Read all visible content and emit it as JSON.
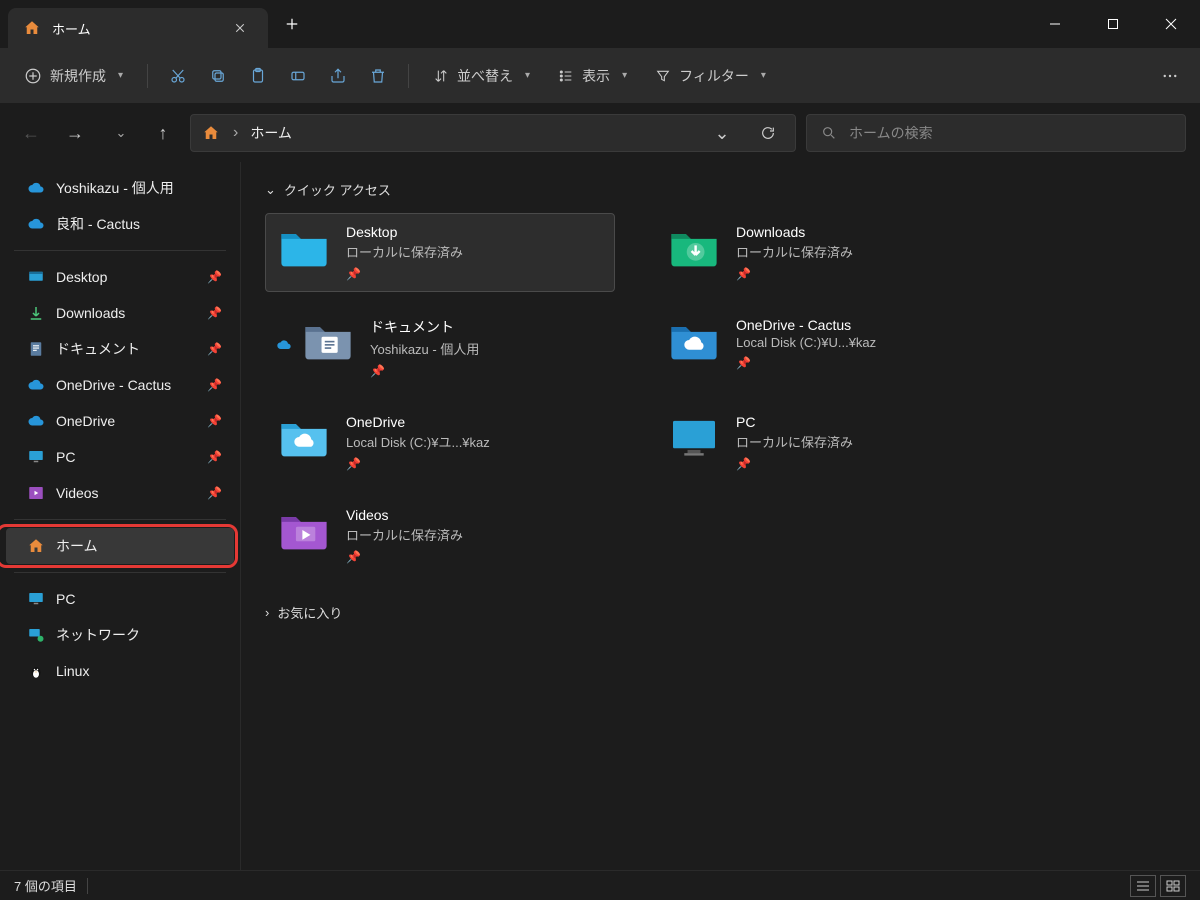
{
  "window": {
    "tab_title": "ホーム"
  },
  "toolbar": {
    "new_label": "新規作成",
    "sort_label": "並べ替え",
    "view_label": "表示",
    "filter_label": "フィルター"
  },
  "address": {
    "segments": [
      "ホーム"
    ]
  },
  "search": {
    "placeholder": "ホームの検索"
  },
  "sidebar": {
    "cloud": [
      {
        "label": "Yoshikazu - 個人用",
        "icon": "cloud-blue"
      },
      {
        "label": "良和 - Cactus",
        "icon": "cloud-blue"
      }
    ],
    "pinned": [
      {
        "label": "Desktop",
        "icon": "desktop",
        "pinned": true
      },
      {
        "label": "Downloads",
        "icon": "download",
        "pinned": true
      },
      {
        "label": "ドキュメント",
        "icon": "document",
        "pinned": true
      },
      {
        "label": "OneDrive - Cactus",
        "icon": "cloud-blue",
        "pinned": true
      },
      {
        "label": "OneDrive",
        "icon": "cloud-blue",
        "pinned": true
      },
      {
        "label": "PC",
        "icon": "monitor",
        "pinned": true
      },
      {
        "label": "Videos",
        "icon": "videos",
        "pinned": true
      }
    ],
    "home": {
      "label": "ホーム"
    },
    "locations": [
      {
        "label": "PC",
        "icon": "monitor"
      },
      {
        "label": "ネットワーク",
        "icon": "network"
      },
      {
        "label": "Linux",
        "icon": "linux"
      }
    ]
  },
  "content": {
    "group_quick_access": "クイック アクセス",
    "group_favorites": "お気に入り",
    "items": [
      {
        "title": "Desktop",
        "sub": "ローカルに保存済み",
        "icon": "folder-cyan",
        "selected": true,
        "cloud_badge": false
      },
      {
        "title": "Downloads",
        "sub": "ローカルに保存済み",
        "icon": "folder-download",
        "selected": false,
        "cloud_badge": false
      },
      {
        "title": "ドキュメント",
        "sub": "Yoshikazu - 個人用",
        "icon": "folder-doc",
        "selected": false,
        "cloud_badge": true
      },
      {
        "title": "OneDrive - Cactus",
        "sub": "Local Disk (C:)¥U...¥kaz",
        "icon": "folder-cloud",
        "selected": false,
        "cloud_badge": false
      },
      {
        "title": "OneDrive",
        "sub": "Local Disk (C:)¥ユ...¥kaz",
        "icon": "folder-cloud-lt",
        "selected": false,
        "cloud_badge": false
      },
      {
        "title": "PC",
        "sub": "ローカルに保存済み",
        "icon": "monitor-big",
        "selected": false,
        "cloud_badge": false
      },
      {
        "title": "Videos",
        "sub": "ローカルに保存済み",
        "icon": "folder-video",
        "selected": false,
        "cloud_badge": false
      }
    ]
  },
  "status": {
    "item_count_text": "7 個の項目"
  },
  "colors": {
    "bg": "#1c1c1c",
    "panel": "#2c2c2c",
    "accent_icon": "#69a7d8",
    "highlight_ring": "#e53935"
  }
}
